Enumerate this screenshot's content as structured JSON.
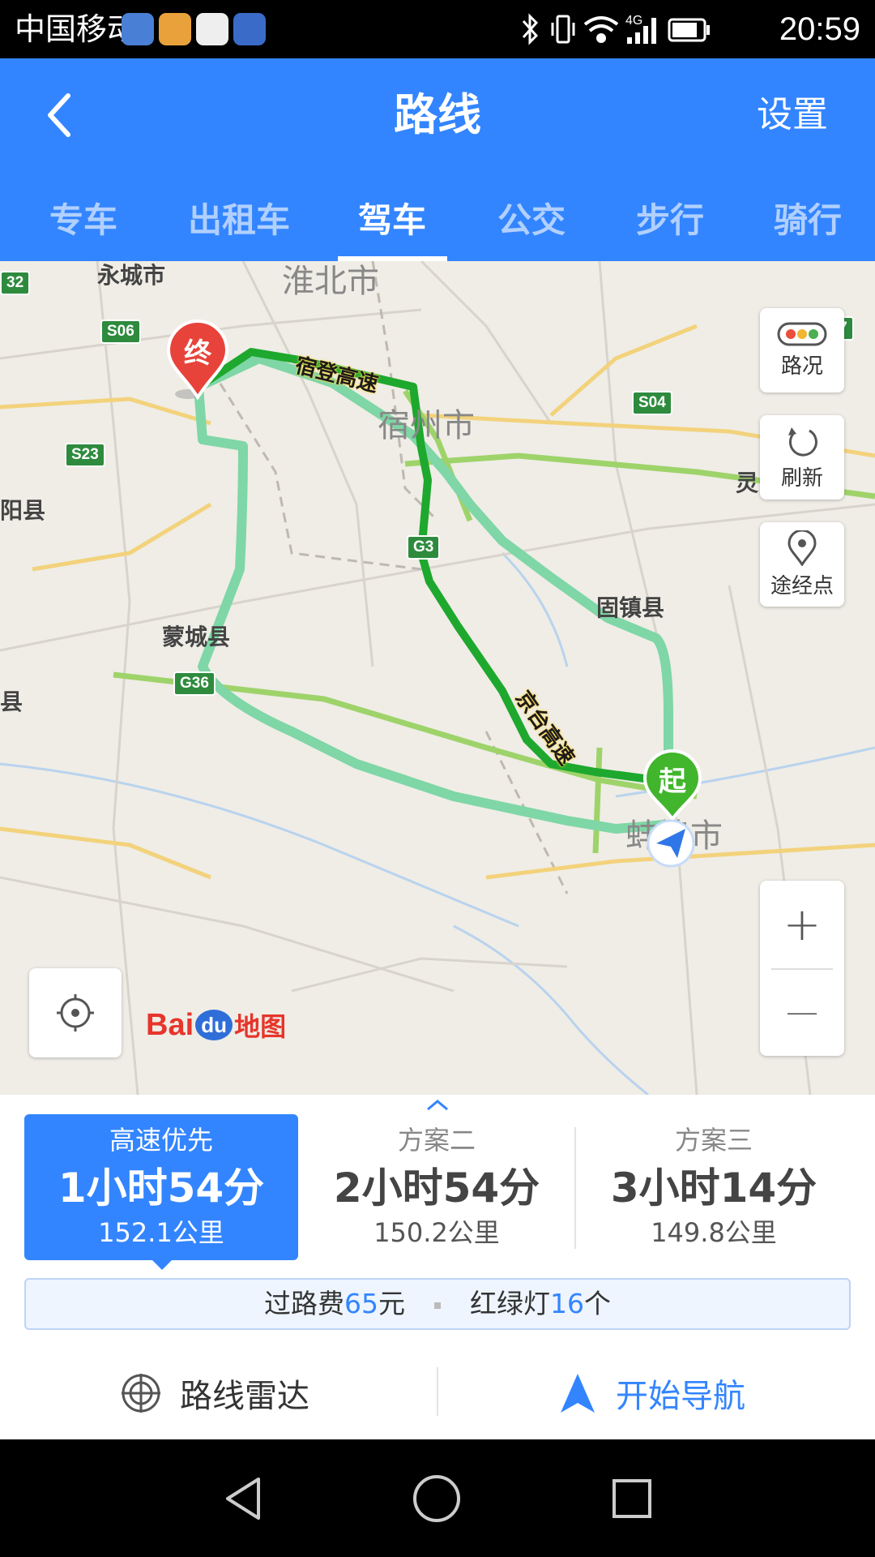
{
  "status": {
    "carrier": "中国移动",
    "network": "4G",
    "time": "20:59"
  },
  "header": {
    "title": "路线",
    "settings": "设置",
    "tabs": [
      "专车",
      "出租车",
      "驾车",
      "公交",
      "步行",
      "骑行"
    ],
    "active_tab": "驾车"
  },
  "map": {
    "places": {
      "huaibei": "淮北市",
      "yongcheng": "永城市",
      "suzhou": "宿州市",
      "guzhen": "固镇县",
      "mengcheng": "蒙城县",
      "bengbu": "蚌埠市",
      "yangxian": "阳县",
      "xian": "县",
      "ling": "灵"
    },
    "shields": {
      "s06": "S06",
      "s07": "S07",
      "s04": "S04",
      "s23": "S23",
      "g3": "G3",
      "g36": "G36",
      "edge": "32"
    },
    "roads": {
      "sudeng": "宿登高速",
      "jingtai": "京台高速"
    },
    "markers": {
      "end": "终",
      "start": "起"
    },
    "side_buttons": {
      "traffic": "路况",
      "refresh": "刷新",
      "waypoint": "途经点"
    },
    "zoom_in": "+",
    "zoom_out": "—",
    "logo": {
      "bai": "Bai",
      "du": "du",
      "ditu": "地图"
    },
    "route_colors": {
      "selected": "#1ea82e",
      "alternative": "#7fd6a6"
    }
  },
  "plans": [
    {
      "name": "高速优先",
      "time": "1小时54分",
      "distance": "152.1公里"
    },
    {
      "name": "方案二",
      "time": "2小时54分",
      "distance": "150.2公里"
    },
    {
      "name": "方案三",
      "time": "3小时14分",
      "distance": "149.8公里"
    }
  ],
  "toll": {
    "toll_label": "过路费",
    "toll_value": "65",
    "toll_unit": "元",
    "lights_label": "红绿灯",
    "lights_value": "16",
    "lights_unit": "个"
  },
  "actions": {
    "radar": "路线雷达",
    "navigate": "开始导航"
  },
  "colors": {
    "accent": "#3385ff"
  }
}
